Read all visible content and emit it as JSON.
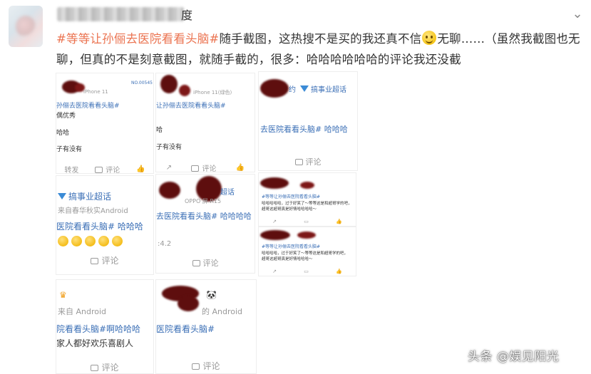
{
  "post": {
    "username_suffix": "度",
    "hashtag": "#等等让孙俪去医院看看头脑#",
    "text_part1": "随手截图，这热搜不是买的我还真不信",
    "text_part2": "无聊……（虽然我截图也无聊，但真的不是刻意截图，就随手截的，很多：哈哈哈哈哈哈的评论我还没截",
    "emoji": "smile-emoji"
  },
  "watermark": "头条 @娱见阳光",
  "shots": {
    "s1": {
      "device": "iPhone 11",
      "hashtag": "孙俪去医院看看头脑#",
      "line1": "偶优秀",
      "line2": "哈哈",
      "line3": "子有没有",
      "badge": "NO.00545",
      "comment": "评论",
      "forward": "转发"
    },
    "s2": {
      "device": "iPhone 11(绿色)",
      "hashtag": "让孙俪去医院看看头脑#",
      "line1": "哈",
      "line2": "子有没有",
      "comment": "评论"
    },
    "s3": {
      "tag": "约",
      "vip": "搞事业超话",
      "text": "去医院看看头脑# 哈哈哈",
      "comment": "评论"
    },
    "s4": {
      "vip": "搞事业超话",
      "source": "来自春华秋实Android",
      "text": "医院看看头脑# 哈哈哈",
      "comment": "评论"
    },
    "s5": {
      "top": "超话",
      "source": "OPPO  屏 R15",
      "text": "去医院看看头脑# 哈哈哈哈",
      "score": "4.2",
      "comment": "评论"
    },
    "s6": {
      "line1": "#等等让孙俪去医院看看头脑#",
      "line2": "哈哈哈哈哈，过于好笑了～等等这是和超哥学的吧，",
      "line3": "超哥这超哥真是好情哈哈哈哈～"
    },
    "s7": {
      "line1": "#等等让孙俪去医院看看头脑#",
      "line2": "哈哈哈哈，过于好笑了～等等这是和超哥学的吧，",
      "line3": "超哥这超哥真是好情哈哈哈～"
    },
    "s8": {
      "source": "来自 Android",
      "text": "院看看头脑#啊哈哈哈",
      "line2": "家人都好欢乐喜剧人",
      "comment": "评论"
    },
    "s9": {
      "source": "的 Android",
      "text": "医院看看头脑#",
      "comment": "评论"
    }
  }
}
